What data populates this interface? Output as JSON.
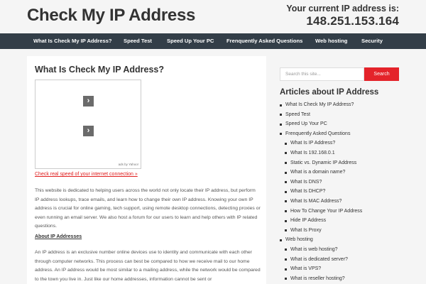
{
  "header": {
    "site_title": "Check My IP Address",
    "ip_label": "Your current IP address is:",
    "ip_value": "148.251.153.164"
  },
  "nav": {
    "items": [
      "What Is Check My IP Address?",
      "Speed Test",
      "Speed Up Your PC",
      "Frenquently Asked Questions",
      "Web hosting",
      "Security"
    ]
  },
  "content": {
    "title": "What Is Check My IP Address?",
    "ad": {
      "credit": "ads by Yahoo!"
    },
    "speed_link": "Check real speed of your internet connection »",
    "paragraph_1": "This website is dedicated to helping users across the world not only locate their IP address, but perform IP address lookups, trace emails, and learn how to change their own IP address. Knowing your own IP address is crucial for online gaming, tech support, using remote desktop connections, detecting proxies or even running an email server. We also host a forum for our users to learn and help others with IP related questions.",
    "about_heading": "About IP Addresses",
    "paragraph_2": "An IP address is an exclusive number online devices use to identity and communicate with each other through computer networks. This process can best be compared to how we receive mail to our home address. An IP address would be most similar to a mailing address, while the network would be compared to the town you live in. Just like our home addresses, information cannot be sent or"
  },
  "sidebar": {
    "search": {
      "placeholder": "Search this site...",
      "button_label": "Search"
    },
    "widget_title": "Articles about IP Address",
    "articles": [
      {
        "label": "What Is Check My IP Address?",
        "level": 0
      },
      {
        "label": "Speed Test",
        "level": 0
      },
      {
        "label": "Speed Up Your PC",
        "level": 0
      },
      {
        "label": "Frenquently Asked Questions",
        "level": 0
      },
      {
        "label": "What Is IP Address?",
        "level": 1
      },
      {
        "label": "What Is 192.168.0.1",
        "level": 1
      },
      {
        "label": "Static vs. Dynamic IP Address",
        "level": 1
      },
      {
        "label": "What is a domain name?",
        "level": 1
      },
      {
        "label": "What Is DNS?",
        "level": 1
      },
      {
        "label": "What Is DHCP?",
        "level": 1
      },
      {
        "label": "What Is MAC Address?",
        "level": 1
      },
      {
        "label": "How To Change Your IP Address",
        "level": 1
      },
      {
        "label": "Hide IP Address",
        "level": 1
      },
      {
        "label": "What Is Proxy",
        "level": 1
      },
      {
        "label": "Web hosting",
        "level": 0
      },
      {
        "label": "What is web hosting?",
        "level": 1
      },
      {
        "label": "What is dedicated server?",
        "level": 1
      },
      {
        "label": "What is VPS?",
        "level": 1
      },
      {
        "label": "What is reseller hosting?",
        "level": 1
      }
    ]
  },
  "colors": {
    "nav_background": "#333e48",
    "accent_red": "#e4232a",
    "page_background": "#f5f5f5"
  },
  "icons": {
    "ad_arrow": "chevron-right-icon"
  }
}
